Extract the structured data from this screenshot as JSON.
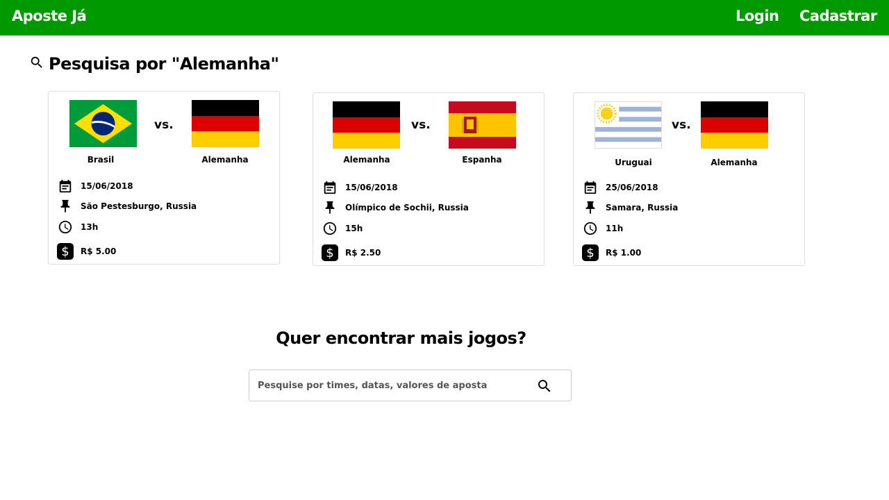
{
  "header": {
    "brand": "Aposte Já",
    "login_label": "Login",
    "signup_label": "Cadastrar",
    "bg_color": "#009900"
  },
  "search_result": {
    "title": "Pesquisa por \"Alemanha\"",
    "icon": "search-icon"
  },
  "matches": [
    {
      "home": {
        "name": "Brasil",
        "flag": "brazil-flag"
      },
      "away": {
        "name": "Alemanha",
        "flag": "germany-flag"
      },
      "vs": "vs.",
      "date": "15/06/2018",
      "venue": "São Pestesburgo, Russia",
      "time": "13h",
      "bet": "R$ 5.00"
    },
    {
      "home": {
        "name": "Alemanha",
        "flag": "germany-flag"
      },
      "away": {
        "name": "Espanha",
        "flag": "spain-flag"
      },
      "vs": "vs.",
      "date": "15/06/2018",
      "venue": "Olímpico de Sochii, Russia",
      "time": "15h",
      "bet": "R$ 2.50"
    },
    {
      "home": {
        "name": "Uruguai",
        "flag": "uruguay-flag"
      },
      "away": {
        "name": "Alemanha",
        "flag": "germany-flag"
      },
      "vs": "vs.",
      "date": "25/06/2018",
      "venue": "Samara, Russia",
      "time": "11h",
      "bet": "R$ 1.00"
    }
  ],
  "icons": {
    "date": "calendar-icon",
    "venue": "pin-icon",
    "time": "clock-icon",
    "bet": "dollar-icon"
  },
  "dollar_symbol": "$",
  "more": {
    "title": "Quer encontrar mais jogos?",
    "placeholder": "Pesquise por times, datas, valores de aposta"
  }
}
